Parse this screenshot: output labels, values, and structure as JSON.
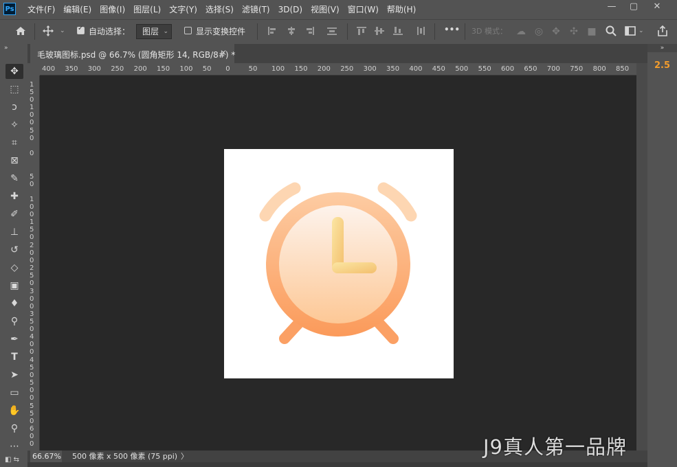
{
  "app": {
    "logo": "Ps"
  },
  "menu": [
    "文件(F)",
    "编辑(E)",
    "图像(I)",
    "图层(L)",
    "文字(Y)",
    "选择(S)",
    "滤镜(T)",
    "3D(D)",
    "视图(V)",
    "窗口(W)",
    "帮助(H)"
  ],
  "window_controls": {
    "minimize": "—",
    "maximize": "▢",
    "close": "✕"
  },
  "options": {
    "auto_select_label": "自动选择：",
    "auto_select_checked": true,
    "layer_select_value": "图层",
    "show_transform_label": "显示变换控件",
    "show_transform_checked": false,
    "more": "•••",
    "mode_3d_label": "3D 模式："
  },
  "document": {
    "tab_title": "毛玻璃图标.psd @ 66.7% (圆角矩形 14, RGB/8#) *",
    "close": "✕"
  },
  "ruler_top_labels": [
    "400",
    "350",
    "300",
    "250",
    "200",
    "150",
    "100",
    "50",
    "0",
    "50",
    "100",
    "150",
    "200",
    "250",
    "300",
    "350",
    "400",
    "450",
    "500",
    "550",
    "600",
    "650",
    "700",
    "750",
    "800",
    "850"
  ],
  "ruler_left_labels": [
    "1 5 0",
    "1 0 0",
    "5 0",
    "0",
    "5 0",
    "1 0 0",
    "1 5 0",
    "2 0 0",
    "2 5 0",
    "3 0 0",
    "3 5 0",
    "4 0 0",
    "4 5 0",
    "5 0 0",
    "5 5 0",
    "6 0 0"
  ],
  "right_panel": {
    "value": "2.5",
    "collapse": "»"
  },
  "toolbar_collapse": "»",
  "status": {
    "zoom": "66.67%",
    "doc_info": "500 像素 x 500 像素 (75 ppi)",
    "arrow": "〉"
  },
  "watermark": "J9真人第一品牌",
  "colors": {
    "accent": "#f39c2c",
    "clock_light": "#fde7d4",
    "clock_dark": "#fb9b5c",
    "hand": "#f6c978"
  },
  "tools": [
    "move-tool-icon",
    "marquee-tool-icon",
    "lasso-tool-icon",
    "magic-wand-tool-icon",
    "crop-tool-icon",
    "frame-tool-icon",
    "eyedropper-tool-icon",
    "healing-brush-tool-icon",
    "brush-tool-icon",
    "stamp-tool-icon",
    "history-brush-tool-icon",
    "eraser-tool-icon",
    "gradient-tool-icon",
    "blur-tool-icon",
    "dodge-tool-icon",
    "pen-tool-icon",
    "type-tool-icon",
    "path-select-tool-icon",
    "rectangle-tool-icon",
    "hand-tool-icon",
    "zoom-tool-icon",
    "more-tools-icon"
  ]
}
